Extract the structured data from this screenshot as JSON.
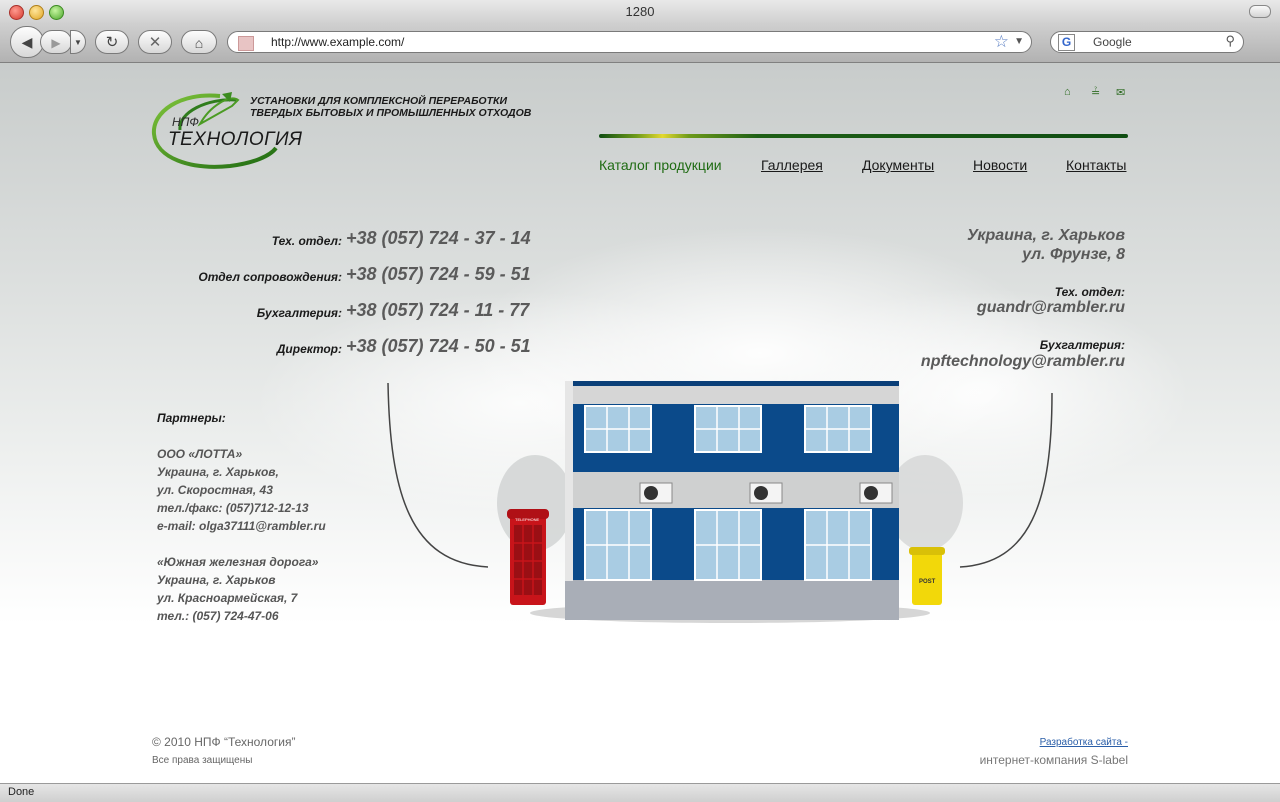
{
  "window": {
    "title": "1280"
  },
  "toolbar": {
    "url": "http://www.example.com/",
    "search_placeholder": "Google"
  },
  "header": {
    "logo_small": "НПФ",
    "logo_name": "ТЕХНОЛОГИЯ",
    "tagline_line1": "УСТАНОВКИ ДЛЯ КОМПЛЕКСНОЙ ПЕРЕРАБОТКИ",
    "tagline_line2": "ТВЕРДЫХ БЫТОВЫХ И ПРОМЫШЛЕННЫХ ОТХОДОВ",
    "top_icons": [
      "home-icon",
      "sitemap-icon",
      "mail-icon"
    ]
  },
  "nav": {
    "items": [
      {
        "label": "Каталог продукции",
        "active": true
      },
      {
        "label": "Галлерея"
      },
      {
        "label": "Документы"
      },
      {
        "label": "Новости"
      },
      {
        "label": "Контакты"
      }
    ]
  },
  "contacts": {
    "phones": [
      {
        "label": "Тех. отдел:",
        "phone": "+38 (057) 724 - 37 - 14"
      },
      {
        "label": "Отдел сопровождения:",
        "phone": "+38 (057) 724 - 59 - 51"
      },
      {
        "label": "Бухгалтерия:",
        "phone": "+38 (057) 724 - 11 - 77"
      },
      {
        "label": "Директор:",
        "phone": "+38 (057) 724 - 50 - 51"
      }
    ],
    "address_line1": "Украина, г. Харьков",
    "address_line2": "ул. Фрунзе, 8",
    "tech_label": "Тех. отдел:",
    "tech_email": "guandr@rambler.ru",
    "acc_label": "Бухгалтерия:",
    "acc_email": "npftechnology@rambler.ru"
  },
  "partners": {
    "heading": "Партнеры:",
    "p1": [
      "ООО «ЛОТТА»",
      "Украина, г. Харьков,",
      "ул. Скоростная, 43",
      "тел./факс: (057)712-12-13",
      "e-mail: olga37111@rambler.ru"
    ],
    "p2": [
      "«Южная железная дорога»",
      "Украина, г. Харьков",
      "ул. Красноармейская, 7",
      "тел.: (057) 724-47-06"
    ]
  },
  "scene": {
    "phonebox_sign": "TELEPHONE",
    "postbox_label": "POST"
  },
  "footer": {
    "copyright": "© 2010 НПФ “Технология”",
    "rights": "Все права защищены",
    "dev_link": "Разработка сайта -",
    "dev_company": "интернет-компания S-label"
  },
  "status": {
    "text": "Done"
  },
  "colors": {
    "accent_green": "#1f6b13",
    "building_blue": "#0b4a8a",
    "phonebox_red": "#c8141a",
    "postbox_yellow": "#f2d80a"
  }
}
